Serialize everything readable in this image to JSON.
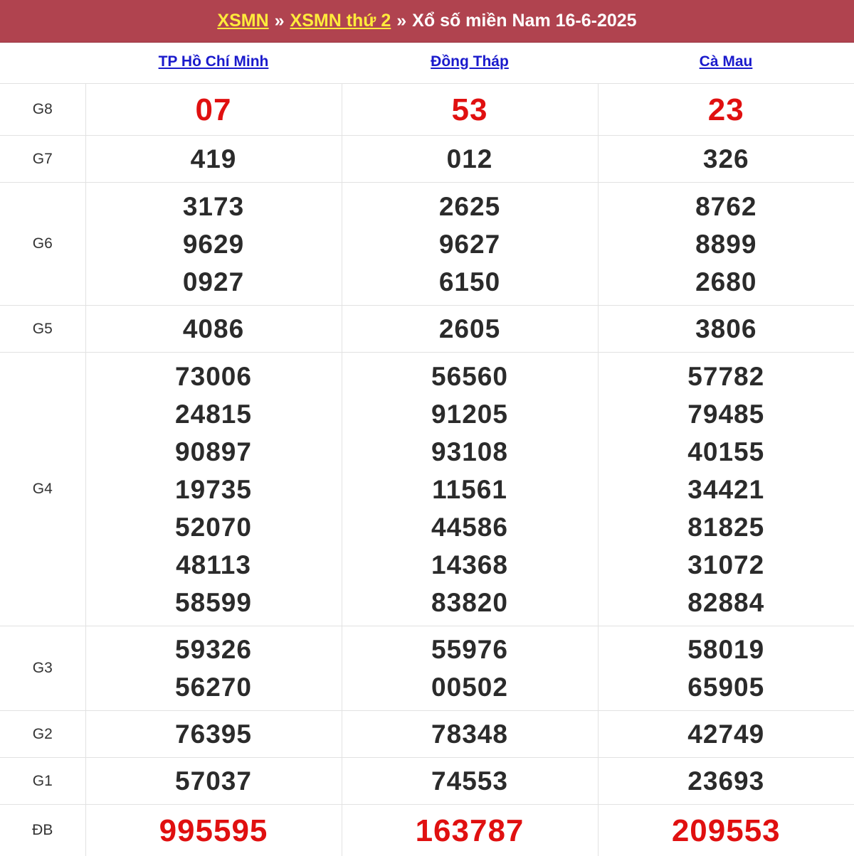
{
  "header": {
    "link1": "XSMN",
    "sep1": "»",
    "link2": "XSMN thứ 2",
    "sep2": "»",
    "title": "Xổ số miền Nam 16-6-2025"
  },
  "colors": {
    "header_bg": "#b0434f",
    "link_yellow": "#ffeb3b",
    "special_red": "#e01010",
    "province_link": "#1a1acc"
  },
  "provinces": [
    "TP Hồ Chí Minh",
    "Đồng Tháp",
    "Cà Mau"
  ],
  "prizes": [
    {
      "label": "G8",
      "results": [
        [
          "07"
        ],
        [
          "53"
        ],
        [
          "23"
        ]
      ]
    },
    {
      "label": "G7",
      "results": [
        [
          "419"
        ],
        [
          "012"
        ],
        [
          "326"
        ]
      ]
    },
    {
      "label": "G6",
      "results": [
        [
          "3173",
          "9629",
          "0927"
        ],
        [
          "2625",
          "9627",
          "6150"
        ],
        [
          "8762",
          "8899",
          "2680"
        ]
      ]
    },
    {
      "label": "G5",
      "results": [
        [
          "4086"
        ],
        [
          "2605"
        ],
        [
          "3806"
        ]
      ]
    },
    {
      "label": "G4",
      "results": [
        [
          "73006",
          "24815",
          "90897",
          "19735",
          "52070",
          "48113",
          "58599"
        ],
        [
          "56560",
          "91205",
          "93108",
          "11561",
          "44586",
          "14368",
          "83820"
        ],
        [
          "57782",
          "79485",
          "40155",
          "34421",
          "81825",
          "31072",
          "82884"
        ]
      ]
    },
    {
      "label": "G3",
      "results": [
        [
          "59326",
          "56270"
        ],
        [
          "55976",
          "00502"
        ],
        [
          "58019",
          "65905"
        ]
      ]
    },
    {
      "label": "G2",
      "results": [
        [
          "76395"
        ],
        [
          "78348"
        ],
        [
          "42749"
        ]
      ]
    },
    {
      "label": "G1",
      "results": [
        [
          "57037"
        ],
        [
          "74553"
        ],
        [
          "23693"
        ]
      ]
    },
    {
      "label": "ĐB",
      "results": [
        [
          "995595"
        ],
        [
          "163787"
        ],
        [
          "209553"
        ]
      ]
    }
  ]
}
